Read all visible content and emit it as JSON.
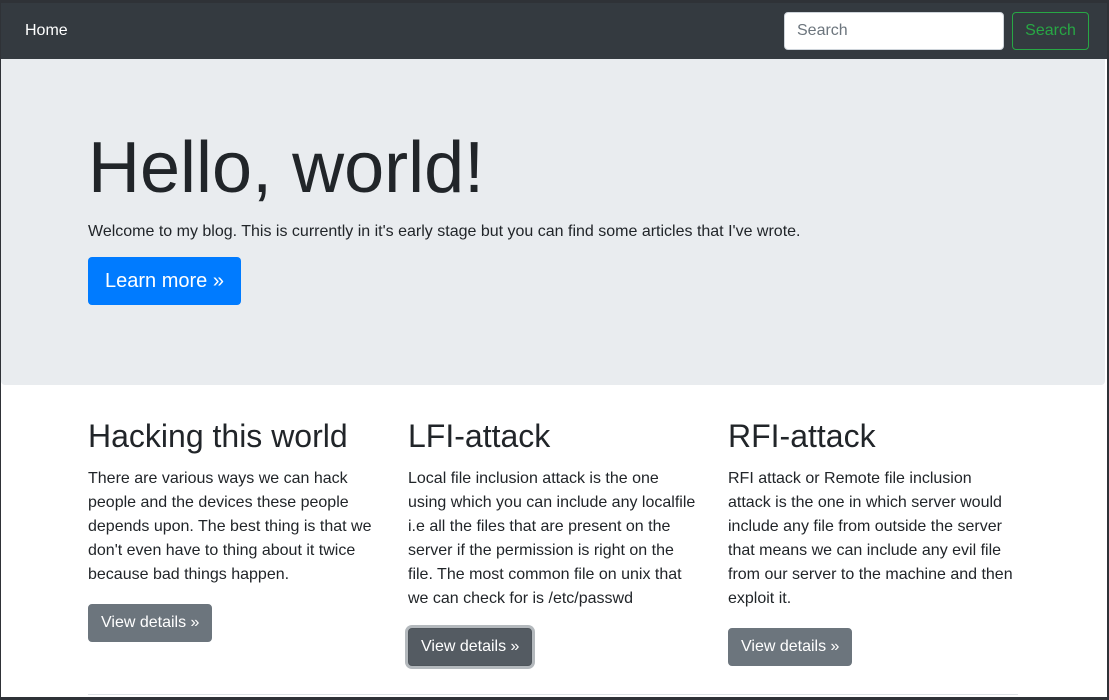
{
  "navbar": {
    "home_label": "Home",
    "search_placeholder": "Search",
    "search_button_label": "Search"
  },
  "hero": {
    "title": "Hello, world!",
    "lead": "Welcome to my blog. This is currently in it's early stage but you can find some articles that I've wrote.",
    "button_label": "Learn more »"
  },
  "columns": [
    {
      "title": "Hacking this world",
      "text": "There are various ways we can hack people and the devices these people depends upon. The best thing is that we don't even have to thing about it twice because bad things happen.",
      "button_label": "View details »"
    },
    {
      "title": "LFI-attack",
      "text": "Local file inclusion attack is the one using which you can include any localfile i.e all the files that are present on the server if the permission is right on the file. The most common file on unix that we can check for is /etc/passwd",
      "button_label": "View details »"
    },
    {
      "title": "RFI-attack",
      "text": "RFI attack or Remote file inclusion attack is the one in which server would include any file from outside the server that means we can include any evil file from our server to the machine and then exploit it.",
      "button_label": "View details »"
    }
  ],
  "colors": {
    "navbar_bg": "#343a40",
    "jumbotron_bg": "#e9ecef",
    "primary": "#007bff",
    "success": "#28a745",
    "secondary": "#6c757d"
  }
}
